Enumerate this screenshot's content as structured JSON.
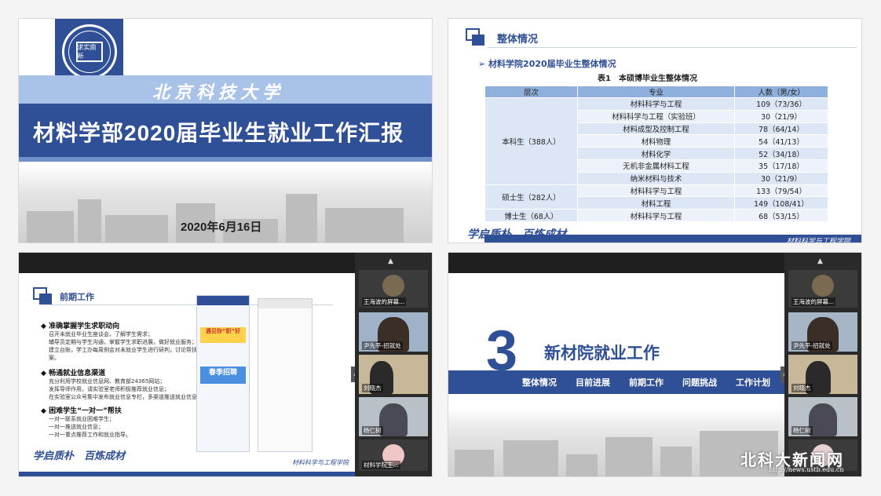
{
  "panel1": {
    "calligraphy": "北京科技大学",
    "title": "材料学部2020届毕业生就业工作汇报",
    "date": "2020年6月16日",
    "logo_text": "求实鼎新"
  },
  "panel2": {
    "section_title": "整体情况",
    "subheading": "➢ 材料学院2020届毕业生整体情况",
    "caption": "表1　本硕博毕业生整体情况",
    "headers": [
      "层次",
      "专业",
      "人数（男/女）"
    ],
    "groups": [
      {
        "level": "本科生（388人）",
        "rows": [
          [
            "材料科学与工程",
            "109（73/36）"
          ],
          [
            "材料科学与工程（实验班）",
            "30（21/9）"
          ],
          [
            "材料成型及控制工程",
            "78（64/14）"
          ],
          [
            "材料物理",
            "54（41/13）"
          ],
          [
            "材料化学",
            "52（34/18）"
          ],
          [
            "无机非金属材料工程",
            "35（17/18）"
          ],
          [
            "纳米材料与技术",
            "30（21/9）"
          ]
        ]
      },
      {
        "level": "硕士生（282人）",
        "rows": [
          [
            "材料科学与工程",
            "133（79/54）"
          ],
          [
            "材料工程",
            "149（108/41）"
          ]
        ]
      },
      {
        "level": "博士生（68人）",
        "rows": [
          [
            "材料科学与工程",
            "68（53/15）"
          ]
        ]
      }
    ],
    "footer_callig": "学启质朴　百炼成材",
    "footer_dept": "材料科学与工程学院"
  },
  "panel3": {
    "section_title": "前期工作",
    "b1_title": "准确掌握学生求职动向",
    "b1_lines": [
      "召开未就业毕业生座谈会，了解学生需求；",
      "辅导员定期与学生沟通，掌握学生求职进展，做好就业服务；",
      "建立台账，学工办每周例会对未就业学生进行研判，讨论帮扶方案。"
    ],
    "b2_title": "畅通就业信息渠道",
    "b2_lines": [
      "充分利用学校就业信息网、教育部24365网站；",
      "发挥导师作用，请实验室老师积极推荐就业信息；",
      "在实验室公众号集中发布就业信息专栏，多渠道推送就业信息。"
    ],
    "b3_title": "困难学生“一对一”帮扶",
    "b3_lines": [
      "一对一联系就业困难学生；",
      "一对一推送就业信息；",
      "一对一重点推荐工作和就业指导。"
    ],
    "footer_callig": "学启质朴　百炼成材",
    "footer_dept": "材料科学与工程学院",
    "phone_banner1": "遇见你“职”好",
    "phone_banner2": "春季招聘",
    "cams": [
      "王海波的屏幕...",
      "尹先平-招就处",
      "刘晓杰",
      "杨仁树",
      "材料学院王..."
    ]
  },
  "panel4": {
    "number": "3",
    "title": "新材院就业工作",
    "nav": [
      "整体情况",
      "目前进展",
      "前期工作",
      "问题挑战",
      "工作计划"
    ],
    "cams": [
      "王海波的屏幕...",
      "尹先平-招就处",
      "刘晓杰",
      "杨仁树"
    ]
  },
  "watermark": {
    "text": "北科大新闻网",
    "url": "http://news.ustb.edu.cn"
  }
}
